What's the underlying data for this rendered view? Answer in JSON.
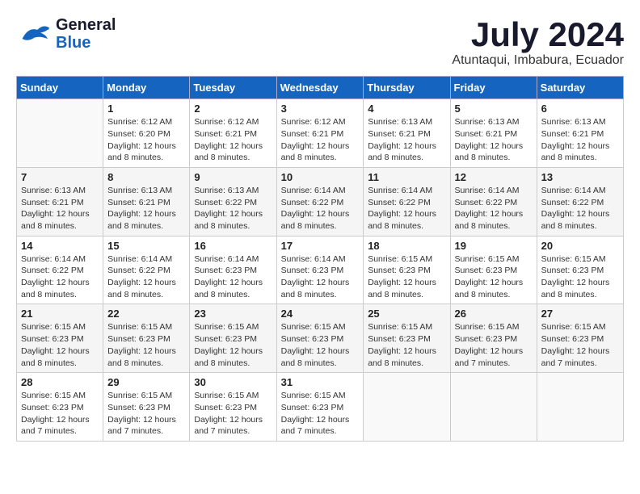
{
  "header": {
    "logo_line1": "General",
    "logo_line2": "Blue",
    "month": "July 2024",
    "location": "Atuntaqui, Imbabura, Ecuador"
  },
  "weekdays": [
    "Sunday",
    "Monday",
    "Tuesday",
    "Wednesday",
    "Thursday",
    "Friday",
    "Saturday"
  ],
  "weeks": [
    [
      {
        "day": "",
        "info": ""
      },
      {
        "day": "1",
        "info": "Sunrise: 6:12 AM\nSunset: 6:20 PM\nDaylight: 12 hours\nand 8 minutes."
      },
      {
        "day": "2",
        "info": "Sunrise: 6:12 AM\nSunset: 6:21 PM\nDaylight: 12 hours\nand 8 minutes."
      },
      {
        "day": "3",
        "info": "Sunrise: 6:12 AM\nSunset: 6:21 PM\nDaylight: 12 hours\nand 8 minutes."
      },
      {
        "day": "4",
        "info": "Sunrise: 6:13 AM\nSunset: 6:21 PM\nDaylight: 12 hours\nand 8 minutes."
      },
      {
        "day": "5",
        "info": "Sunrise: 6:13 AM\nSunset: 6:21 PM\nDaylight: 12 hours\nand 8 minutes."
      },
      {
        "day": "6",
        "info": "Sunrise: 6:13 AM\nSunset: 6:21 PM\nDaylight: 12 hours\nand 8 minutes."
      }
    ],
    [
      {
        "day": "7",
        "info": "Sunrise: 6:13 AM\nSunset: 6:21 PM\nDaylight: 12 hours\nand 8 minutes."
      },
      {
        "day": "8",
        "info": "Sunrise: 6:13 AM\nSunset: 6:21 PM\nDaylight: 12 hours\nand 8 minutes."
      },
      {
        "day": "9",
        "info": "Sunrise: 6:13 AM\nSunset: 6:22 PM\nDaylight: 12 hours\nand 8 minutes."
      },
      {
        "day": "10",
        "info": "Sunrise: 6:14 AM\nSunset: 6:22 PM\nDaylight: 12 hours\nand 8 minutes."
      },
      {
        "day": "11",
        "info": "Sunrise: 6:14 AM\nSunset: 6:22 PM\nDaylight: 12 hours\nand 8 minutes."
      },
      {
        "day": "12",
        "info": "Sunrise: 6:14 AM\nSunset: 6:22 PM\nDaylight: 12 hours\nand 8 minutes."
      },
      {
        "day": "13",
        "info": "Sunrise: 6:14 AM\nSunset: 6:22 PM\nDaylight: 12 hours\nand 8 minutes."
      }
    ],
    [
      {
        "day": "14",
        "info": "Sunrise: 6:14 AM\nSunset: 6:22 PM\nDaylight: 12 hours\nand 8 minutes."
      },
      {
        "day": "15",
        "info": "Sunrise: 6:14 AM\nSunset: 6:22 PM\nDaylight: 12 hours\nand 8 minutes."
      },
      {
        "day": "16",
        "info": "Sunrise: 6:14 AM\nSunset: 6:23 PM\nDaylight: 12 hours\nand 8 minutes."
      },
      {
        "day": "17",
        "info": "Sunrise: 6:14 AM\nSunset: 6:23 PM\nDaylight: 12 hours\nand 8 minutes."
      },
      {
        "day": "18",
        "info": "Sunrise: 6:15 AM\nSunset: 6:23 PM\nDaylight: 12 hours\nand 8 minutes."
      },
      {
        "day": "19",
        "info": "Sunrise: 6:15 AM\nSunset: 6:23 PM\nDaylight: 12 hours\nand 8 minutes."
      },
      {
        "day": "20",
        "info": "Sunrise: 6:15 AM\nSunset: 6:23 PM\nDaylight: 12 hours\nand 8 minutes."
      }
    ],
    [
      {
        "day": "21",
        "info": "Sunrise: 6:15 AM\nSunset: 6:23 PM\nDaylight: 12 hours\nand 8 minutes."
      },
      {
        "day": "22",
        "info": "Sunrise: 6:15 AM\nSunset: 6:23 PM\nDaylight: 12 hours\nand 8 minutes."
      },
      {
        "day": "23",
        "info": "Sunrise: 6:15 AM\nSunset: 6:23 PM\nDaylight: 12 hours\nand 8 minutes."
      },
      {
        "day": "24",
        "info": "Sunrise: 6:15 AM\nSunset: 6:23 PM\nDaylight: 12 hours\nand 8 minutes."
      },
      {
        "day": "25",
        "info": "Sunrise: 6:15 AM\nSunset: 6:23 PM\nDaylight: 12 hours\nand 8 minutes."
      },
      {
        "day": "26",
        "info": "Sunrise: 6:15 AM\nSunset: 6:23 PM\nDaylight: 12 hours\nand 7 minutes."
      },
      {
        "day": "27",
        "info": "Sunrise: 6:15 AM\nSunset: 6:23 PM\nDaylight: 12 hours\nand 7 minutes."
      }
    ],
    [
      {
        "day": "28",
        "info": "Sunrise: 6:15 AM\nSunset: 6:23 PM\nDaylight: 12 hours\nand 7 minutes."
      },
      {
        "day": "29",
        "info": "Sunrise: 6:15 AM\nSunset: 6:23 PM\nDaylight: 12 hours\nand 7 minutes."
      },
      {
        "day": "30",
        "info": "Sunrise: 6:15 AM\nSunset: 6:23 PM\nDaylight: 12 hours\nand 7 minutes."
      },
      {
        "day": "31",
        "info": "Sunrise: 6:15 AM\nSunset: 6:23 PM\nDaylight: 12 hours\nand 7 minutes."
      },
      {
        "day": "",
        "info": ""
      },
      {
        "day": "",
        "info": ""
      },
      {
        "day": "",
        "info": ""
      }
    ]
  ]
}
